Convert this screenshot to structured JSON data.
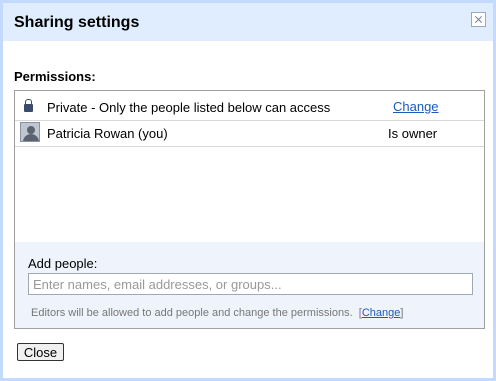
{
  "dialog": {
    "title": "Sharing settings",
    "close_icon": "close-icon"
  },
  "permissions": {
    "heading": "Permissions:",
    "visibility": {
      "icon": "lock-icon",
      "text": "Private - Only the people listed below can access",
      "change_link": "Change"
    },
    "people": [
      {
        "name": "Patricia Rowan (you)",
        "role": "Is owner",
        "icon": "avatar"
      }
    ]
  },
  "add_people": {
    "label": "Add people:",
    "placeholder": "Enter names, email addresses, or groups...",
    "value": "",
    "hint_text": "Editors will be allowed to add people and change the permissions.",
    "hint_bracket_open": "[",
    "hint_link": "Change",
    "hint_bracket_close": "]"
  },
  "footer": {
    "close_label": "Close"
  },
  "colors": {
    "titlebar_bg": "#e0edfe",
    "border": "#c3d9ff",
    "link": "#1a5bbd",
    "add_section_bg": "#eef3fc"
  }
}
